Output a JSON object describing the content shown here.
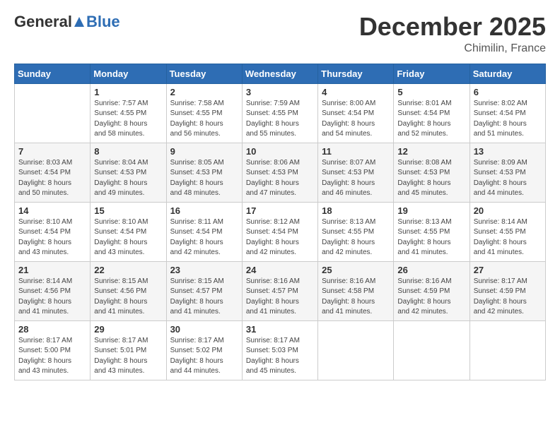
{
  "header": {
    "logo_general": "General",
    "logo_blue": "Blue",
    "month_title": "December 2025",
    "location": "Chimilin, France"
  },
  "days_of_week": [
    "Sunday",
    "Monday",
    "Tuesday",
    "Wednesday",
    "Thursday",
    "Friday",
    "Saturday"
  ],
  "weeks": [
    [
      {
        "day": "",
        "info": ""
      },
      {
        "day": "1",
        "info": "Sunrise: 7:57 AM\nSunset: 4:55 PM\nDaylight: 8 hours\nand 58 minutes."
      },
      {
        "day": "2",
        "info": "Sunrise: 7:58 AM\nSunset: 4:55 PM\nDaylight: 8 hours\nand 56 minutes."
      },
      {
        "day": "3",
        "info": "Sunrise: 7:59 AM\nSunset: 4:55 PM\nDaylight: 8 hours\nand 55 minutes."
      },
      {
        "day": "4",
        "info": "Sunrise: 8:00 AM\nSunset: 4:54 PM\nDaylight: 8 hours\nand 54 minutes."
      },
      {
        "day": "5",
        "info": "Sunrise: 8:01 AM\nSunset: 4:54 PM\nDaylight: 8 hours\nand 52 minutes."
      },
      {
        "day": "6",
        "info": "Sunrise: 8:02 AM\nSunset: 4:54 PM\nDaylight: 8 hours\nand 51 minutes."
      }
    ],
    [
      {
        "day": "7",
        "info": "Sunrise: 8:03 AM\nSunset: 4:54 PM\nDaylight: 8 hours\nand 50 minutes."
      },
      {
        "day": "8",
        "info": "Sunrise: 8:04 AM\nSunset: 4:53 PM\nDaylight: 8 hours\nand 49 minutes."
      },
      {
        "day": "9",
        "info": "Sunrise: 8:05 AM\nSunset: 4:53 PM\nDaylight: 8 hours\nand 48 minutes."
      },
      {
        "day": "10",
        "info": "Sunrise: 8:06 AM\nSunset: 4:53 PM\nDaylight: 8 hours\nand 47 minutes."
      },
      {
        "day": "11",
        "info": "Sunrise: 8:07 AM\nSunset: 4:53 PM\nDaylight: 8 hours\nand 46 minutes."
      },
      {
        "day": "12",
        "info": "Sunrise: 8:08 AM\nSunset: 4:53 PM\nDaylight: 8 hours\nand 45 minutes."
      },
      {
        "day": "13",
        "info": "Sunrise: 8:09 AM\nSunset: 4:53 PM\nDaylight: 8 hours\nand 44 minutes."
      }
    ],
    [
      {
        "day": "14",
        "info": "Sunrise: 8:10 AM\nSunset: 4:54 PM\nDaylight: 8 hours\nand 43 minutes."
      },
      {
        "day": "15",
        "info": "Sunrise: 8:10 AM\nSunset: 4:54 PM\nDaylight: 8 hours\nand 43 minutes."
      },
      {
        "day": "16",
        "info": "Sunrise: 8:11 AM\nSunset: 4:54 PM\nDaylight: 8 hours\nand 42 minutes."
      },
      {
        "day": "17",
        "info": "Sunrise: 8:12 AM\nSunset: 4:54 PM\nDaylight: 8 hours\nand 42 minutes."
      },
      {
        "day": "18",
        "info": "Sunrise: 8:13 AM\nSunset: 4:55 PM\nDaylight: 8 hours\nand 42 minutes."
      },
      {
        "day": "19",
        "info": "Sunrise: 8:13 AM\nSunset: 4:55 PM\nDaylight: 8 hours\nand 41 minutes."
      },
      {
        "day": "20",
        "info": "Sunrise: 8:14 AM\nSunset: 4:55 PM\nDaylight: 8 hours\nand 41 minutes."
      }
    ],
    [
      {
        "day": "21",
        "info": "Sunrise: 8:14 AM\nSunset: 4:56 PM\nDaylight: 8 hours\nand 41 minutes."
      },
      {
        "day": "22",
        "info": "Sunrise: 8:15 AM\nSunset: 4:56 PM\nDaylight: 8 hours\nand 41 minutes."
      },
      {
        "day": "23",
        "info": "Sunrise: 8:15 AM\nSunset: 4:57 PM\nDaylight: 8 hours\nand 41 minutes."
      },
      {
        "day": "24",
        "info": "Sunrise: 8:16 AM\nSunset: 4:57 PM\nDaylight: 8 hours\nand 41 minutes."
      },
      {
        "day": "25",
        "info": "Sunrise: 8:16 AM\nSunset: 4:58 PM\nDaylight: 8 hours\nand 41 minutes."
      },
      {
        "day": "26",
        "info": "Sunrise: 8:16 AM\nSunset: 4:59 PM\nDaylight: 8 hours\nand 42 minutes."
      },
      {
        "day": "27",
        "info": "Sunrise: 8:17 AM\nSunset: 4:59 PM\nDaylight: 8 hours\nand 42 minutes."
      }
    ],
    [
      {
        "day": "28",
        "info": "Sunrise: 8:17 AM\nSunset: 5:00 PM\nDaylight: 8 hours\nand 43 minutes."
      },
      {
        "day": "29",
        "info": "Sunrise: 8:17 AM\nSunset: 5:01 PM\nDaylight: 8 hours\nand 43 minutes."
      },
      {
        "day": "30",
        "info": "Sunrise: 8:17 AM\nSunset: 5:02 PM\nDaylight: 8 hours\nand 44 minutes."
      },
      {
        "day": "31",
        "info": "Sunrise: 8:17 AM\nSunset: 5:03 PM\nDaylight: 8 hours\nand 45 minutes."
      },
      {
        "day": "",
        "info": ""
      },
      {
        "day": "",
        "info": ""
      },
      {
        "day": "",
        "info": ""
      }
    ]
  ]
}
